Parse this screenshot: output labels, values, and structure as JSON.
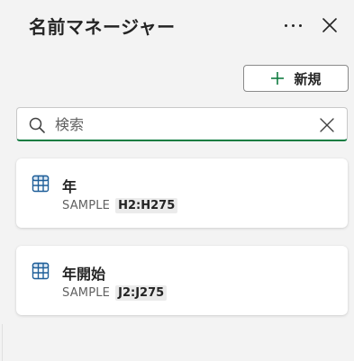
{
  "panel": {
    "title": "名前マネージャー",
    "more_icon": "more-horizontal-icon",
    "close_icon": "close-icon"
  },
  "toolbar": {
    "new_label": "新規",
    "new_icon": "plus-icon"
  },
  "search": {
    "placeholder": "検索",
    "value": "",
    "icon": "search-icon",
    "clear_icon": "clear-icon"
  },
  "names": [
    {
      "name": "年",
      "scope": "SAMPLE",
      "range": "H2:H275",
      "icon": "table-icon"
    },
    {
      "name": "年開始",
      "scope": "SAMPLE",
      "range": "J2:J275",
      "icon": "table-icon"
    }
  ],
  "colors": {
    "accent_green": "#107c41",
    "background": "#f3f3f3",
    "card": "#ffffff",
    "table_icon": "#1f5f99"
  }
}
